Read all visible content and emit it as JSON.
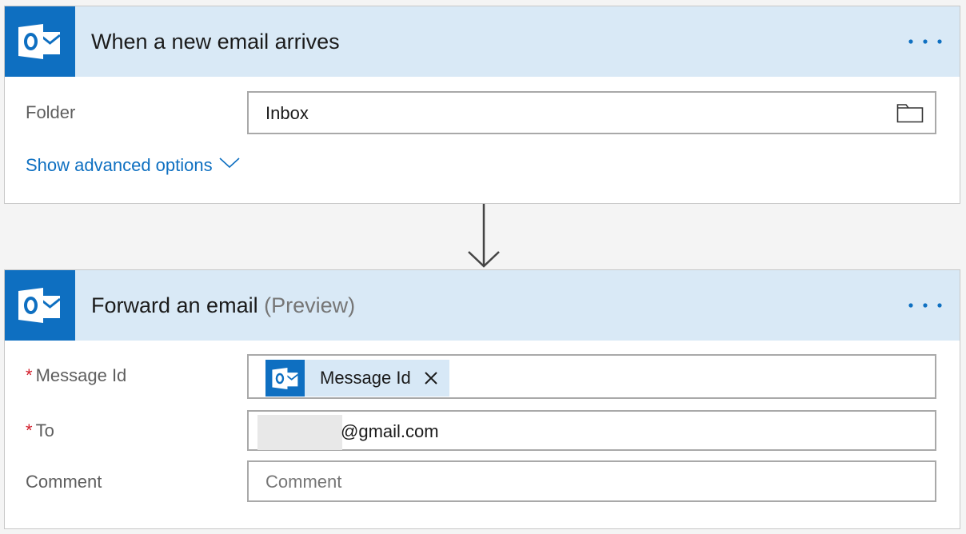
{
  "trigger": {
    "title": "When a new email arrives",
    "app_icon": "outlook-icon",
    "more_icon": "more-options-icon",
    "fields": {
      "folder": {
        "label": "Folder",
        "value": "Inbox",
        "picker_icon": "folder-icon"
      }
    },
    "advanced_link": "Show advanced options",
    "advanced_icon": "chevron-down-icon"
  },
  "connector_icon": "arrow-down-icon",
  "action": {
    "title": "Forward an email",
    "title_suffix": "(Preview)",
    "app_icon": "outlook-icon",
    "more_icon": "more-options-icon",
    "fields": {
      "message_id": {
        "label": "Message Id",
        "required_mark": "*",
        "token_label": "Message Id",
        "token_icon": "outlook-icon",
        "remove_icon": "close-icon"
      },
      "to": {
        "label": "To",
        "required_mark": "*",
        "value": "@gmail.com"
      },
      "comment": {
        "label": "Comment",
        "placeholder": "Comment"
      }
    }
  },
  "colors": {
    "accent": "#0e6fc1",
    "header_bg": "#d9e9f6",
    "link": "#0f70c1",
    "required": "#d21c29"
  }
}
